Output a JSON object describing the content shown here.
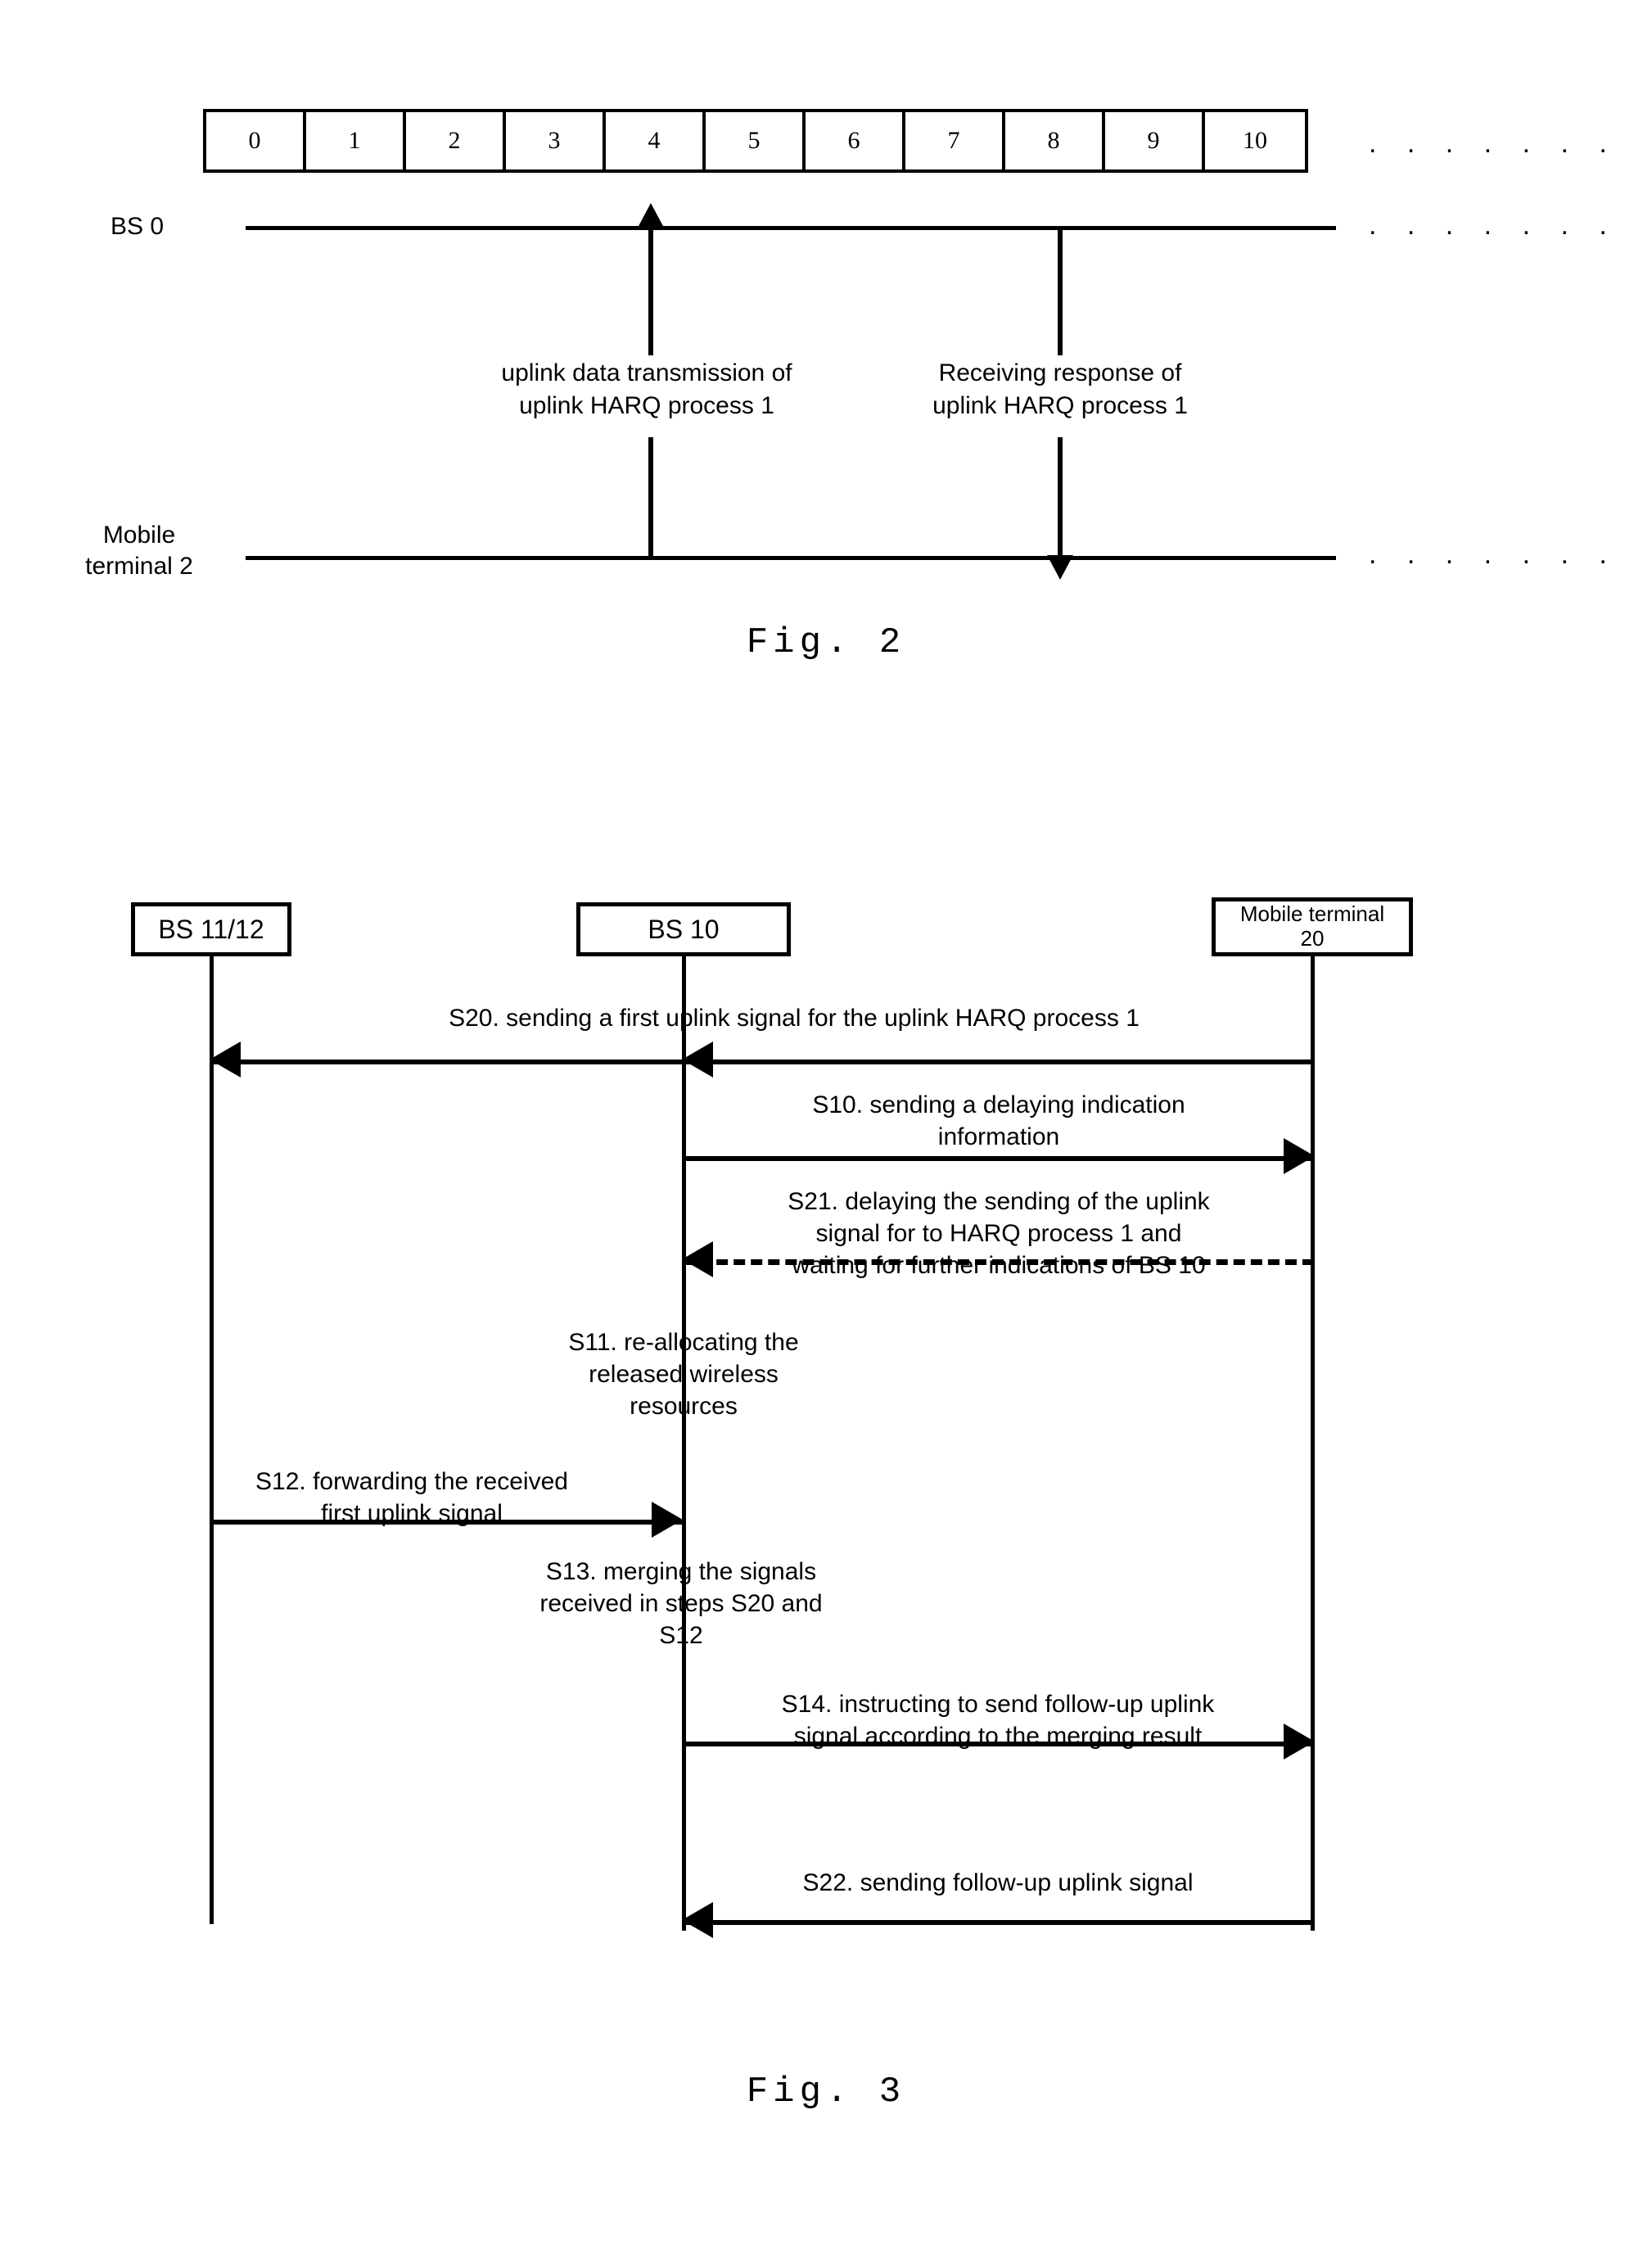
{
  "figure2": {
    "caption": "Fig. 2",
    "slots": [
      "0",
      "1",
      "2",
      "3",
      "4",
      "5",
      "6",
      "7",
      "8",
      "9",
      "10"
    ],
    "continuation_dots": ". . . . . . .",
    "actors": {
      "bs0": "BS 0",
      "mobile_terminal": "Mobile\nterminal 2"
    },
    "annotations": {
      "uplink": "uplink data transmission of\nuplink  HARQ process 1",
      "response": "Receiving response of\nuplink  HARQ process 1"
    }
  },
  "figure3": {
    "caption": "Fig. 3",
    "actors": {
      "bs1112": "BS 11/12",
      "bs10": "BS 10",
      "mobile_terminal": "Mobile terminal\n20"
    },
    "messages": {
      "s20": "S20. sending a first uplink signal for the uplink HARQ process 1",
      "s10": "S10.  sending a delaying indication\ninformation",
      "s21": "S21. delaying the sending of the uplink\nsignal for to HARQ process 1 and\nwaiting for further indications of BS 10",
      "s11": "S11. re-allocating the\nreleased wireless\nresources",
      "s12": "S12. forwarding the received\nfirst uplink signal",
      "s13": "S13. merging the signals\nreceived in steps S20 and\nS12",
      "s14": "S14. instructing to send follow-up uplink\nsignal according to the merging result",
      "s22": "S22. sending follow-up uplink signal"
    }
  },
  "colors": {
    "ink": "#000000",
    "paper": "#ffffff"
  }
}
